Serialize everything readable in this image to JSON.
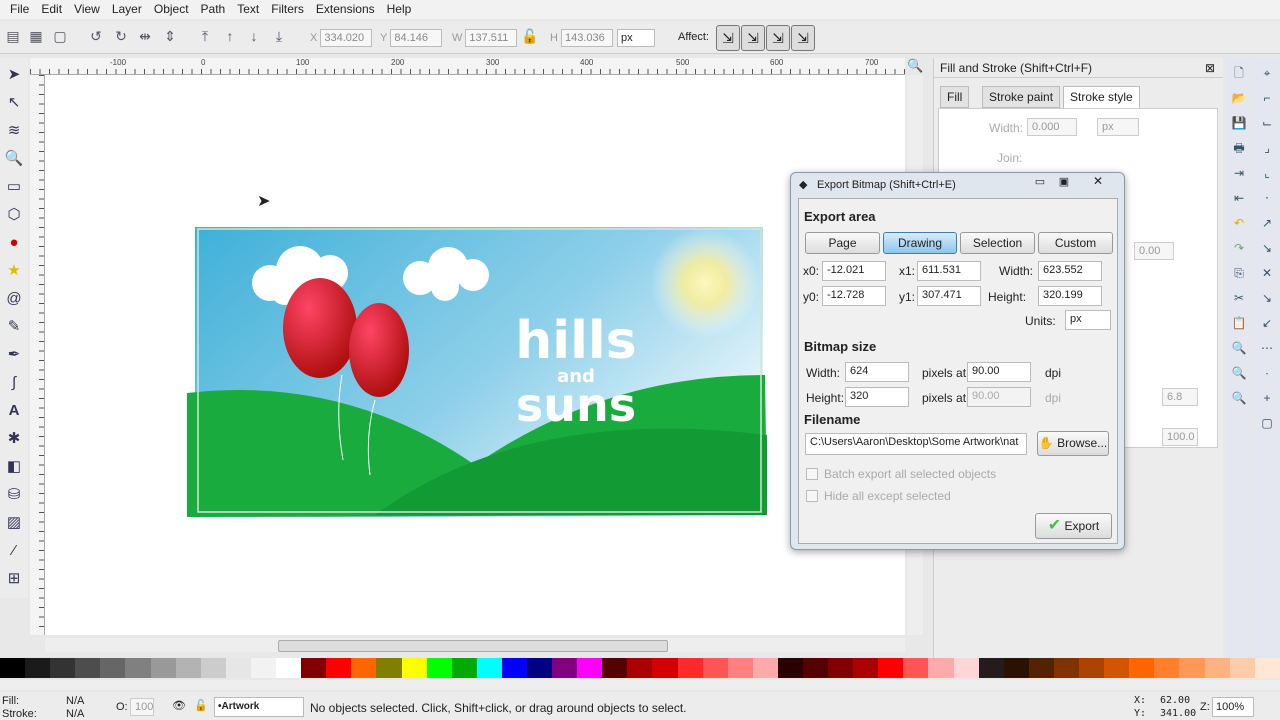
{
  "menu": [
    "File",
    "Edit",
    "View",
    "Layer",
    "Object",
    "Path",
    "Text",
    "Filters",
    "Extensions",
    "Help"
  ],
  "toolbar": {
    "x_label": "X",
    "x": "334.020",
    "y_label": "Y",
    "y": "84.146",
    "w_label": "W",
    "w": "137.511",
    "h_label": "H",
    "h": "143.036",
    "unit": "px",
    "affect": "Affect:"
  },
  "ruler": [
    "-100",
    "0",
    "100",
    "200",
    "300",
    "400",
    "500",
    "600",
    "700"
  ],
  "artwork": {
    "line1": "hills",
    "line2": "and",
    "line3": "suns"
  },
  "fill_stroke": {
    "title": "Fill and Stroke (Shift+Ctrl+F)",
    "tabs": [
      "Fill",
      "Stroke paint",
      "Stroke style"
    ],
    "width_label": "Width:",
    "width": "0.000",
    "unit": "px",
    "join_label": "Join:",
    "miter": "0.00",
    "val1": "6.8",
    "val2": "100.0"
  },
  "export": {
    "title": "Export Bitmap (Shift+Ctrl+E)",
    "area_heading": "Export area",
    "area_buttons": [
      "Page",
      "Drawing",
      "Selection",
      "Custom"
    ],
    "x0_label": "x0:",
    "x0": "-12.021",
    "x1_label": "x1:",
    "x1": "611.531",
    "width_label": "Width:",
    "width": "623.552",
    "y0_label": "y0:",
    "y0": "-12.728",
    "y1_label": "y1:",
    "y1": "307.471",
    "height_label": "Height:",
    "height": "320.199",
    "units_label": "Units:",
    "units": "px",
    "bitmap_heading": "Bitmap size",
    "bw_label": "Width:",
    "bw": "624",
    "bh_label": "Height:",
    "bh": "320",
    "pixels_at": "pixels at",
    "dpi1": "90.00",
    "dpi2": "90.00",
    "dpi": "dpi",
    "filename_heading": "Filename",
    "filename": "C:\\Users\\Aaron\\Desktop\\Some Artwork\\nat",
    "browse": "Browse...",
    "batch": "Batch export all selected objects",
    "hide": "Hide all except selected",
    "export_btn": "Export"
  },
  "status": {
    "fill_label": "Fill:",
    "fill": "N/A",
    "stroke_label": "Stroke:",
    "stroke": "N/A",
    "opacity_label": "O:",
    "opacity": "100",
    "layer": "•Artwork",
    "message": "No objects selected. Click, Shift+click, or drag around objects to select.",
    "x_label": "X:",
    "x": "62.00",
    "y_label": "Y:",
    "y": "341.00",
    "zoom_label": "Z:",
    "zoom": "100%"
  },
  "palette": [
    "#000000",
    "#1a1a1a",
    "#333333",
    "#4d4d4d",
    "#666666",
    "#808080",
    "#999999",
    "#b3b3b3",
    "#cccccc",
    "#e6e6e6",
    "#f2f2f2",
    "#ffffff",
    "#800000",
    "#ff0000",
    "#ff6600",
    "#808000",
    "#ffff00",
    "#00ff00",
    "#00aa00",
    "#00ffff",
    "#0000ff",
    "#000080",
    "#800080",
    "#ff00ff",
    "#550000",
    "#aa0000",
    "#d40000",
    "#ff2a2a",
    "#ff5555",
    "#ff8080",
    "#ffaaaa",
    "#2b0000",
    "#550000",
    "#800000",
    "#aa0000",
    "#ff0000",
    "#ff5555",
    "#ffaaaa",
    "#ffd5d5",
    "#241c1c",
    "#2b1100",
    "#552200",
    "#803300",
    "#aa4400",
    "#d45500",
    "#ff6600",
    "#ff7f2a",
    "#ff9955",
    "#ffb380",
    "#ffccaa",
    "#ffe6d5"
  ]
}
